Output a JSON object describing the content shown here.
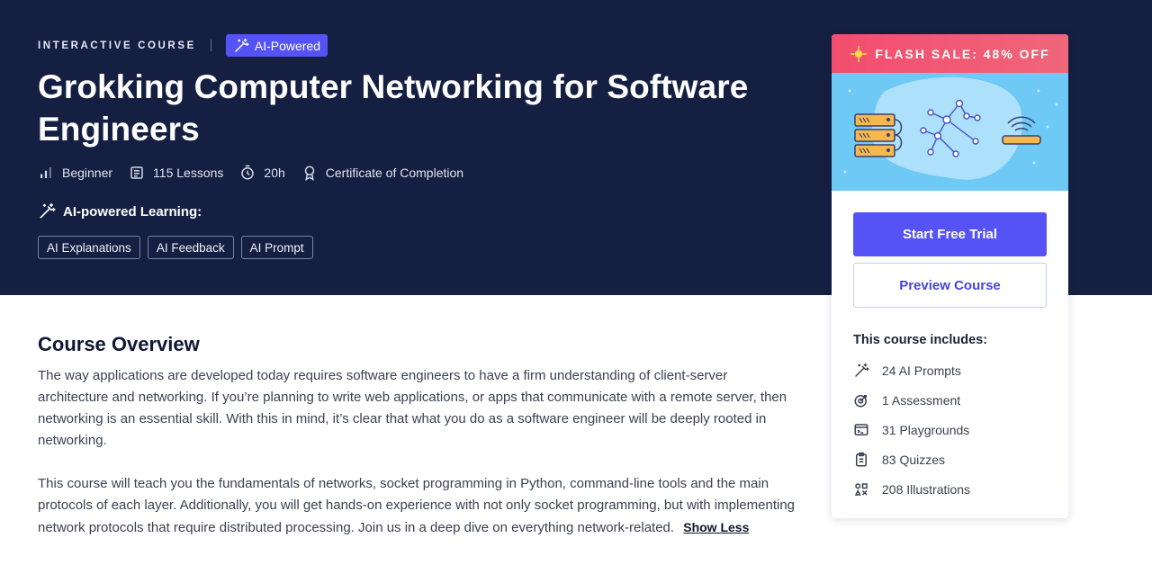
{
  "hero": {
    "eyebrow": "INTERACTIVE COURSE",
    "ai_badge": "AI-Powered",
    "title": "Grokking Computer Networking for Software Engineers",
    "meta": {
      "level": "Beginner",
      "lessons": "115 Lessons",
      "duration": "20h",
      "certificate": "Certificate of Completion"
    },
    "ai_learning_label": "AI-powered Learning:",
    "chips": [
      "AI Explanations",
      "AI Feedback",
      "AI Prompt"
    ]
  },
  "overview": {
    "heading": "Course Overview",
    "paragraph1": "The way applications are developed today requires software engineers to have a firm understanding of client-server architecture and networking. If you’re planning to write web applications, or apps that communicate with a remote server, then networking is an essential skill. With this in mind, it’s clear that what you do as a software engineer will be deeply rooted in networking.",
    "paragraph2": "This course will teach you the fundamentals of networks, socket programming in Python, command-line tools and the main protocols of each layer. Additionally, you will get hands-on experience with not only socket programming, but with implementing network protocols that require distributed processing. Join us in a deep dive on everything network-related.",
    "show_less": "Show Less"
  },
  "card": {
    "flash_sale": "FLASH SALE: 48% OFF",
    "start_trial": "Start Free Trial",
    "preview": "Preview Course",
    "includes_title": "This course includes:",
    "includes": [
      {
        "icon": "magic-wand-icon",
        "label": "24 AI Prompts"
      },
      {
        "icon": "target-icon",
        "label": "1 Assessment"
      },
      {
        "icon": "playground-icon",
        "label": "31 Playgrounds"
      },
      {
        "icon": "clipboard-icon",
        "label": "83 Quizzes"
      },
      {
        "icon": "shapes-icon",
        "label": "208 Illustrations"
      }
    ]
  },
  "colors": {
    "hero_bg": "#151f42",
    "accent": "#5553f5",
    "flash": "#f24d6d",
    "banner": "#6ec9f5"
  }
}
